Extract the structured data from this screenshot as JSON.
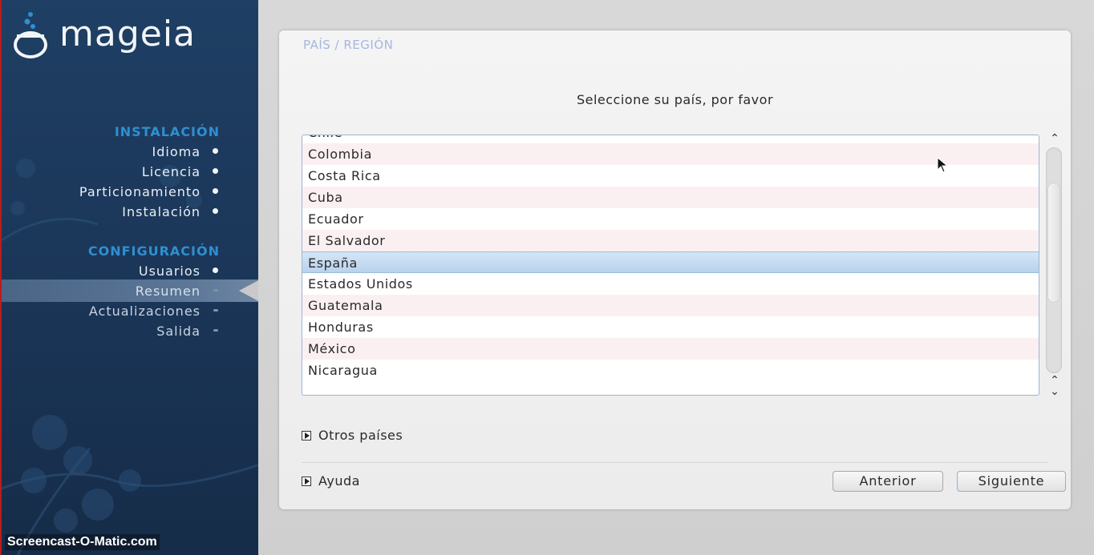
{
  "sidebar": {
    "logo_text": "mageia",
    "sections": [
      {
        "title": "INSTALACIÓN",
        "items": [
          {
            "label": "Idioma",
            "state": "done"
          },
          {
            "label": "Licencia",
            "state": "done"
          },
          {
            "label": "Particionamiento",
            "state": "done"
          },
          {
            "label": "Instalación",
            "state": "done"
          }
        ]
      },
      {
        "title": "CONFIGURACIÓN",
        "items": [
          {
            "label": "Usuarios",
            "state": "done"
          },
          {
            "label": "Resumen",
            "state": "active"
          },
          {
            "label": "Actualizaciones",
            "state": "pending"
          },
          {
            "label": "Salida",
            "state": "pending"
          }
        ]
      }
    ]
  },
  "panel": {
    "title": "PAÍS / REGIÓN",
    "prompt": "Seleccione su país, por favor",
    "countries": [
      "Chile",
      "Colombia",
      "Costa Rica",
      "Cuba",
      "Ecuador",
      "El Salvador",
      "España",
      "Estados Unidos",
      "Guatemala",
      "Honduras",
      "México",
      "Nicaragua"
    ],
    "selected_country": "España",
    "other_countries_label": "Otros países",
    "help_label": "Ayuda",
    "back_button": "Anterior",
    "next_button": "Siguiente"
  },
  "watermark": "Screencast-O-Matic.com",
  "colors": {
    "sidebar_bg": "#1f3f64",
    "section_title": "#2f8fd0",
    "selected_row": "#b9d2ec",
    "panel_title": "#a7b6e0"
  }
}
